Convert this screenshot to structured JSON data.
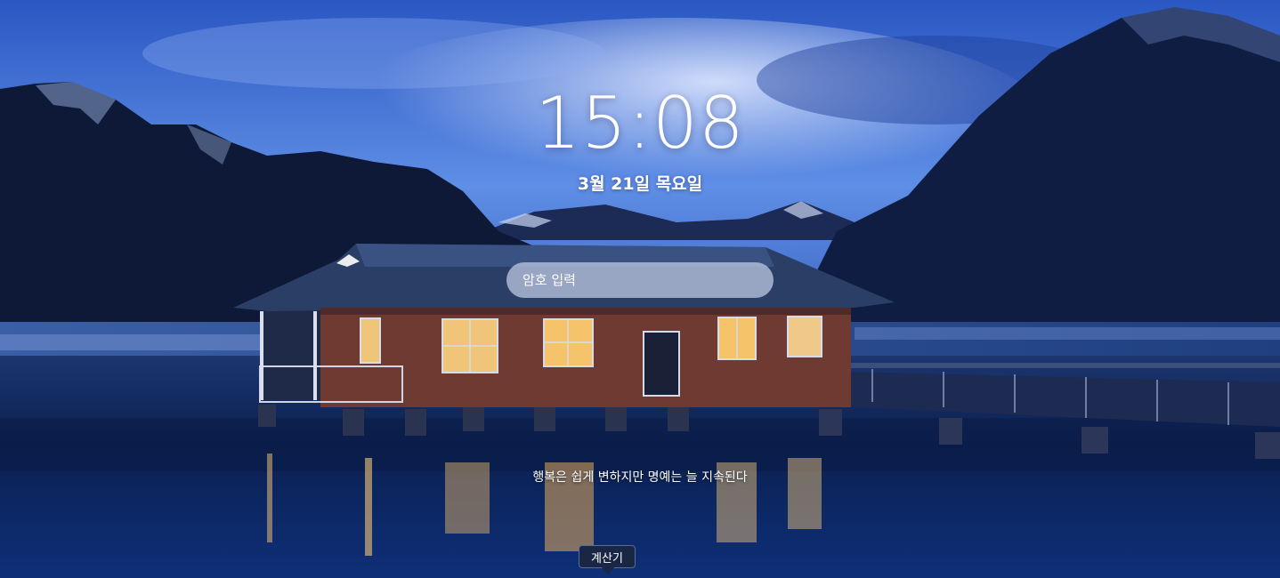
{
  "lockscreen": {
    "time": "15:08",
    "date": "3월 21일 목요일",
    "password_placeholder": "암호 입력",
    "quote": "행복은 쉽게 변하지만 명예는 늘 지속된다",
    "tooltip": "계산기"
  },
  "colors": {
    "sky_top": "#2f5fc8",
    "sky_mid": "#5a86e0",
    "mountain": "#0e1a38",
    "water": "#0c2458",
    "house_wall": "#6e3a32",
    "house_roof": "#2a3e66",
    "window_light": "#f5c46a",
    "input_bg": "#b9c4de"
  }
}
